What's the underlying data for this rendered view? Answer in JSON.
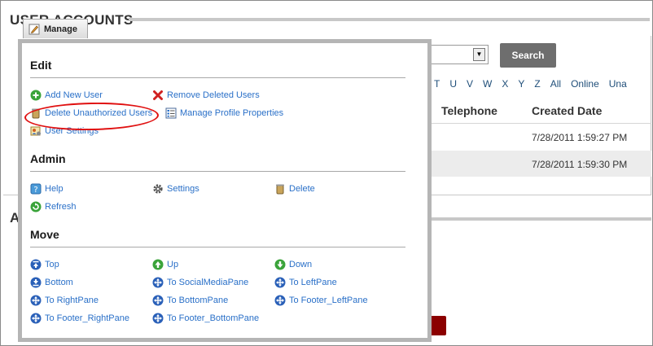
{
  "module": {
    "title": "User Accounts",
    "title_hidden_fragment": "A"
  },
  "search": {
    "button_label": "Search"
  },
  "letters": [
    "T",
    "U",
    "V",
    "W",
    "X",
    "Y",
    "Z",
    "All",
    "Online",
    "Una"
  ],
  "table": {
    "headers": [
      "Telephone",
      "Created Date"
    ],
    "rows": [
      {
        "created": "7/28/2011 1:59:27 PM"
      },
      {
        "created": "7/28/2011 1:59:30 PM"
      }
    ]
  },
  "manage_tab": {
    "label": "Manage"
  },
  "menu": {
    "edit": {
      "title": "Edit",
      "items": [
        {
          "label": "Add New User",
          "icon": "add-icon"
        },
        {
          "label": "Remove Deleted Users",
          "icon": "remove-x-icon"
        },
        {
          "label": "Delete Unauthorized Users",
          "icon": "trash-icon"
        },
        {
          "label": "Manage Profile Properties",
          "icon": "profile-properties-icon"
        },
        {
          "label": "User Settings",
          "icon": "user-settings-icon"
        }
      ]
    },
    "admin": {
      "title": "Admin",
      "items": [
        {
          "label": "Help",
          "icon": "help-icon"
        },
        {
          "label": "Settings",
          "icon": "gear-icon"
        },
        {
          "label": "Delete",
          "icon": "trash-icon"
        },
        {
          "label": "Refresh",
          "icon": "refresh-icon"
        }
      ]
    },
    "move": {
      "title": "Move",
      "items": [
        {
          "label": "Top",
          "icon": "move-top-icon"
        },
        {
          "label": "Up",
          "icon": "move-up-icon"
        },
        {
          "label": "Down",
          "icon": "move-down-icon"
        },
        {
          "label": "Bottom",
          "icon": "move-bottom-icon"
        },
        {
          "label": "To SocialMediaPane",
          "icon": "move-pane-icon"
        },
        {
          "label": "To LeftPane",
          "icon": "move-pane-icon"
        },
        {
          "label": "To RightPane",
          "icon": "move-pane-icon"
        },
        {
          "label": "To BottomPane",
          "icon": "move-pane-icon"
        },
        {
          "label": "To Footer_LeftPane",
          "icon": "move-pane-icon"
        },
        {
          "label": "To Footer_RightPane",
          "icon": "move-pane-icon"
        },
        {
          "label": "To Footer_BottomPane",
          "icon": "move-pane-icon"
        }
      ]
    }
  },
  "colors": {
    "link": "#2a70c8",
    "highlight": "#e01010",
    "search_button": "#6e6e6e"
  }
}
